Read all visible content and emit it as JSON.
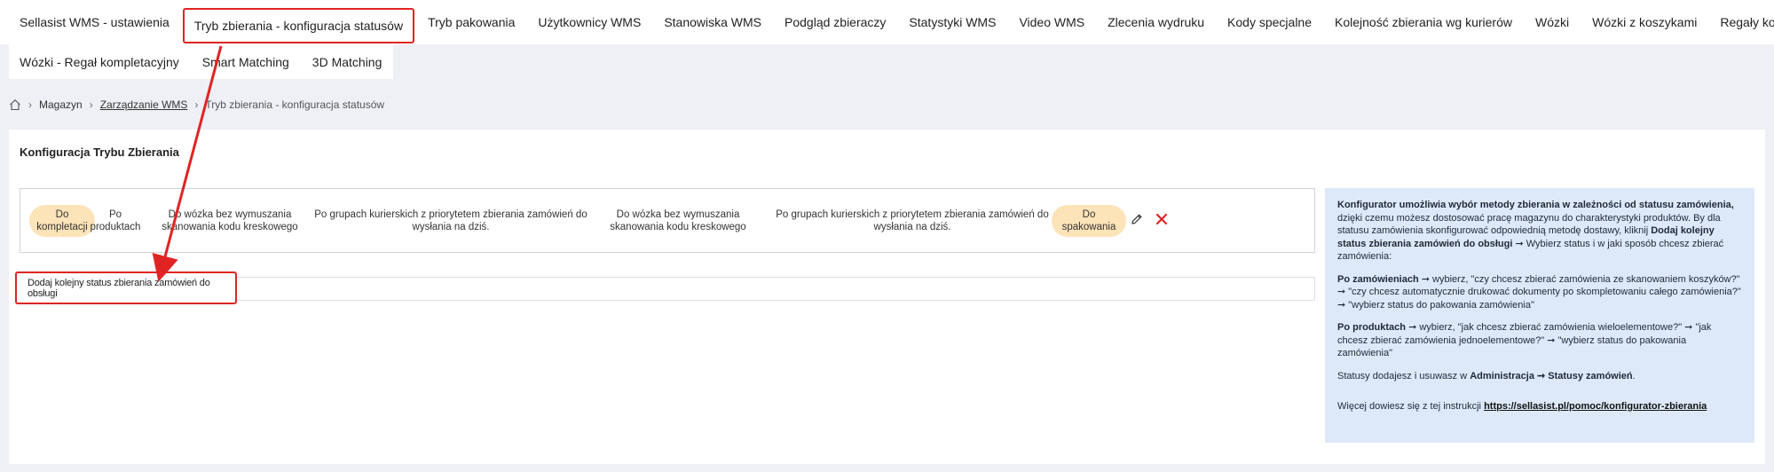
{
  "tabs_row1": [
    "Sellasist WMS - ustawienia",
    "Tryb zbierania - konfiguracja statusów",
    "Tryb pakowania",
    "Użytkownicy WMS",
    "Stanowiska WMS",
    "Podgląd zbieraczy",
    "Statystyki WMS",
    "Video WMS",
    "Zlecenia wydruku",
    "Kody specjalne",
    "Kolejność zbierania wg kurierów",
    "Wózki",
    "Wózki z koszykami",
    "Regały kompletacyjne"
  ],
  "tabs_row2": [
    "Wózki - Regał kompletacyjny",
    "Smart Matching",
    "3D Matching"
  ],
  "breadcrumb": {
    "icon": "home-icon",
    "items": [
      "Magazyn",
      "Zarządzanie WMS",
      "Tryb zbierania - konfiguracja statusów"
    ]
  },
  "card": {
    "title": "Konfiguracja Trybu Zbierania",
    "statuses": [
      "Do kompletacji",
      "Po produktach",
      "Do wózka bez wymuszania skanowania kodu kreskowego",
      "Po grupach kurierskich z priorytetem zbierania zamówień do wysłania na dziś.",
      "Do wózka bez wymuszania skanowania kodu kreskowego",
      "Po grupach kurierskich z priorytetem zbierania zamówień do wysłania na dziś.",
      "Do spakowania"
    ],
    "add_button": "Dodaj kolejny status zbierania zamówień do obsługi"
  },
  "info": {
    "p1_bold": "Konfigurator umożliwia wybór metody zbierania w zależności od statusu zamówienia,",
    "p1_text": " dzięki czemu możesz dostosować pracę magazynu do charakterystyki produktów. By dla statusu zamówienia skonfigurować odpowiednią metodę dostawy, kliknij ",
    "p1_bold2": "Dodaj kolejny status zbierania zamówień do obsługi",
    "p1_text2": " ➞ Wybierz status i w jaki sposób chcesz zbierać zamówienia:",
    "p2_bold": "Po zamówieniach",
    "p2_text": " ➞ wybierz, \"czy chcesz zbierać zamówienia ze skanowaniem koszyków?\" ➞ \"czy chcesz automatycznie drukować dokumenty po skompletowaniu całego zamówienia?\" ➞ \"wybierz status do pakowania zamówienia\"",
    "p3_bold": "Po produktach",
    "p3_text": " ➞ wybierz, \"jak chcesz zbierać zamówienia wieloelementowe?\" ➞ \"jak chcesz zbierać zamówienia jednoelementowe?\" ➞ \"wybierz status do pakowania zamówienia\"",
    "p4_text": "Statusy dodajesz i usuwasz w ",
    "p4_bold": "Administracja ➞ Statusy zamówień",
    "p4_end": ".",
    "p5_text": "Więcej dowiesz się z tej instrukcji ",
    "p5_link": "https://sellasist.pl/pomoc/konfigurator-zbierania"
  },
  "colors": {
    "highlight": "#e02424",
    "pill": "#fde3b8",
    "info_bg": "#dde9f9"
  }
}
